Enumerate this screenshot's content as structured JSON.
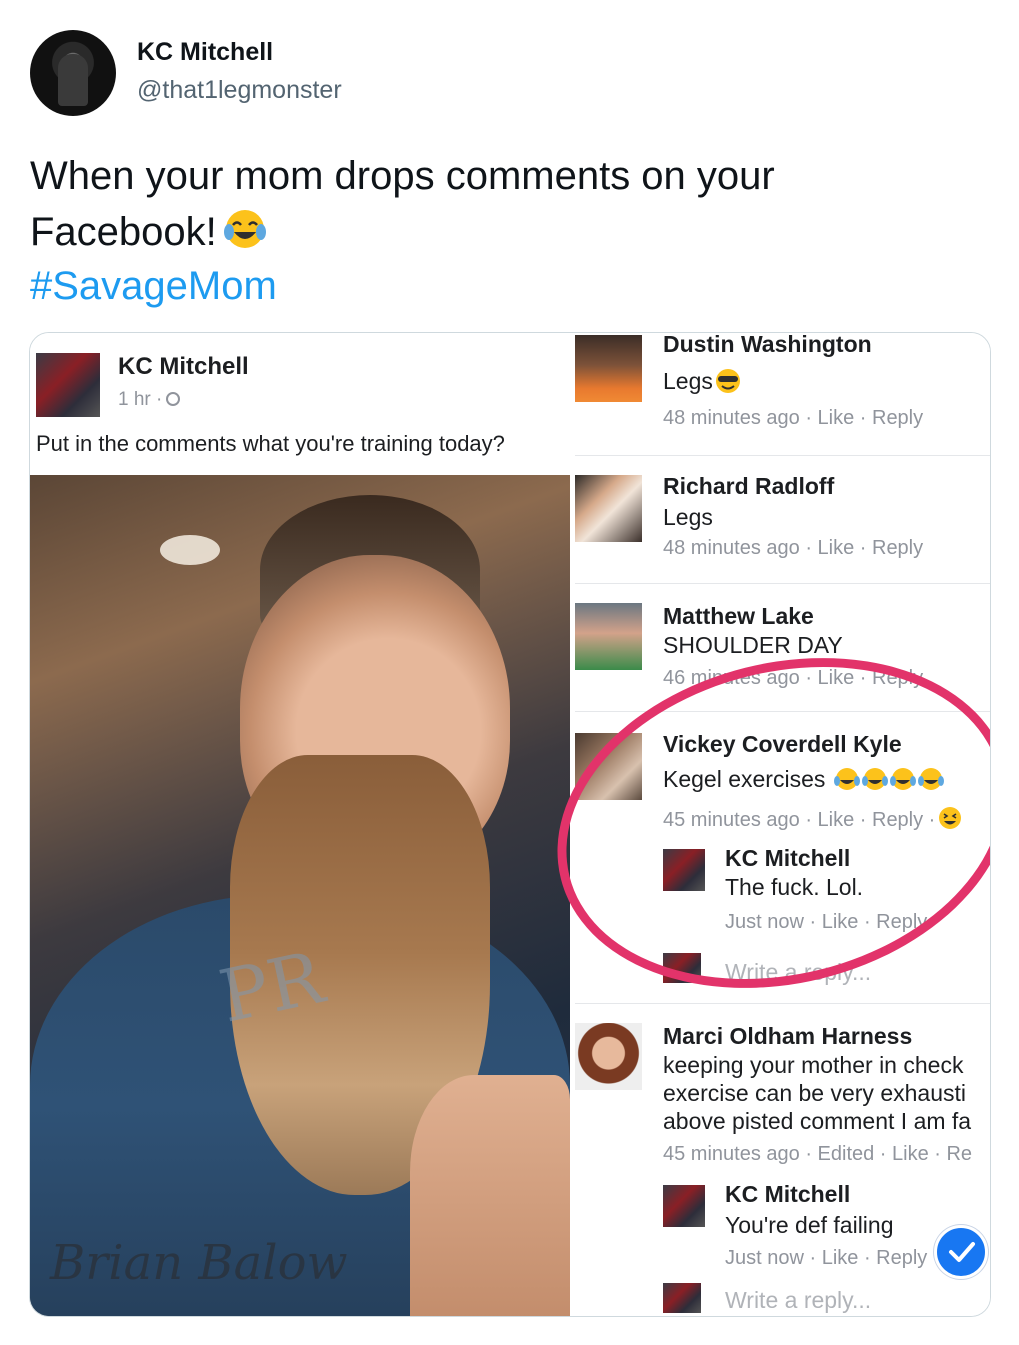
{
  "tweet": {
    "author_name": "KC Mitchell",
    "author_handle": "@that1legmonster",
    "text_line1": "When your mom drops comments on your",
    "text_line2": "Facebook!",
    "text_emoji": "face-with-tears-of-joy",
    "hashtag": "#SavageMom"
  },
  "facebook_post": {
    "author_name": "KC Mitchell",
    "time": "1 hr ·",
    "status": "Put in the comments what you're training today?",
    "photo_shirt_text": "PR",
    "photo_tattoo_text": "Brian Balow"
  },
  "comments": [
    {
      "name": "Dustin Washington",
      "text": "Legs",
      "emoji": "smiling-face-with-sunglasses",
      "meta": "48 minutes ago · Like · Reply"
    },
    {
      "name": "Richard Radloff",
      "text": "Legs",
      "meta": "48 minutes ago · Like · Reply"
    },
    {
      "name": "Matthew Lake",
      "text": "SHOULDER DAY",
      "meta": "46 minutes ago · Like · Reply"
    },
    {
      "name": "Vickey Coverdell Kyle",
      "text": "Kegel exercises",
      "emoji": "face-with-tears-of-joy x4",
      "meta": "45 minutes ago · Like · Reply ·",
      "reply": {
        "name": "KC Mitchell",
        "text": "The fuck. Lol.",
        "meta": "Just now · Like · Reply"
      },
      "write_reply_placeholder": "Write a reply..."
    },
    {
      "name": "Marci Oldham Harness",
      "text_lines": [
        "keeping your mother in check",
        "exercise can be very exhausti",
        "above pisted comment I am fa"
      ],
      "meta": "45 minutes ago · Edited · Like · Re",
      "reply": {
        "name": "KC Mitchell",
        "text": "You're def failing",
        "meta": "Just now · Like · Reply"
      },
      "write_reply_placeholder": "Write a reply..."
    }
  ],
  "colors": {
    "hashtag": "#1d9bf0",
    "annotation_circle": "#e2336a",
    "check_badge": "#1877f2"
  }
}
